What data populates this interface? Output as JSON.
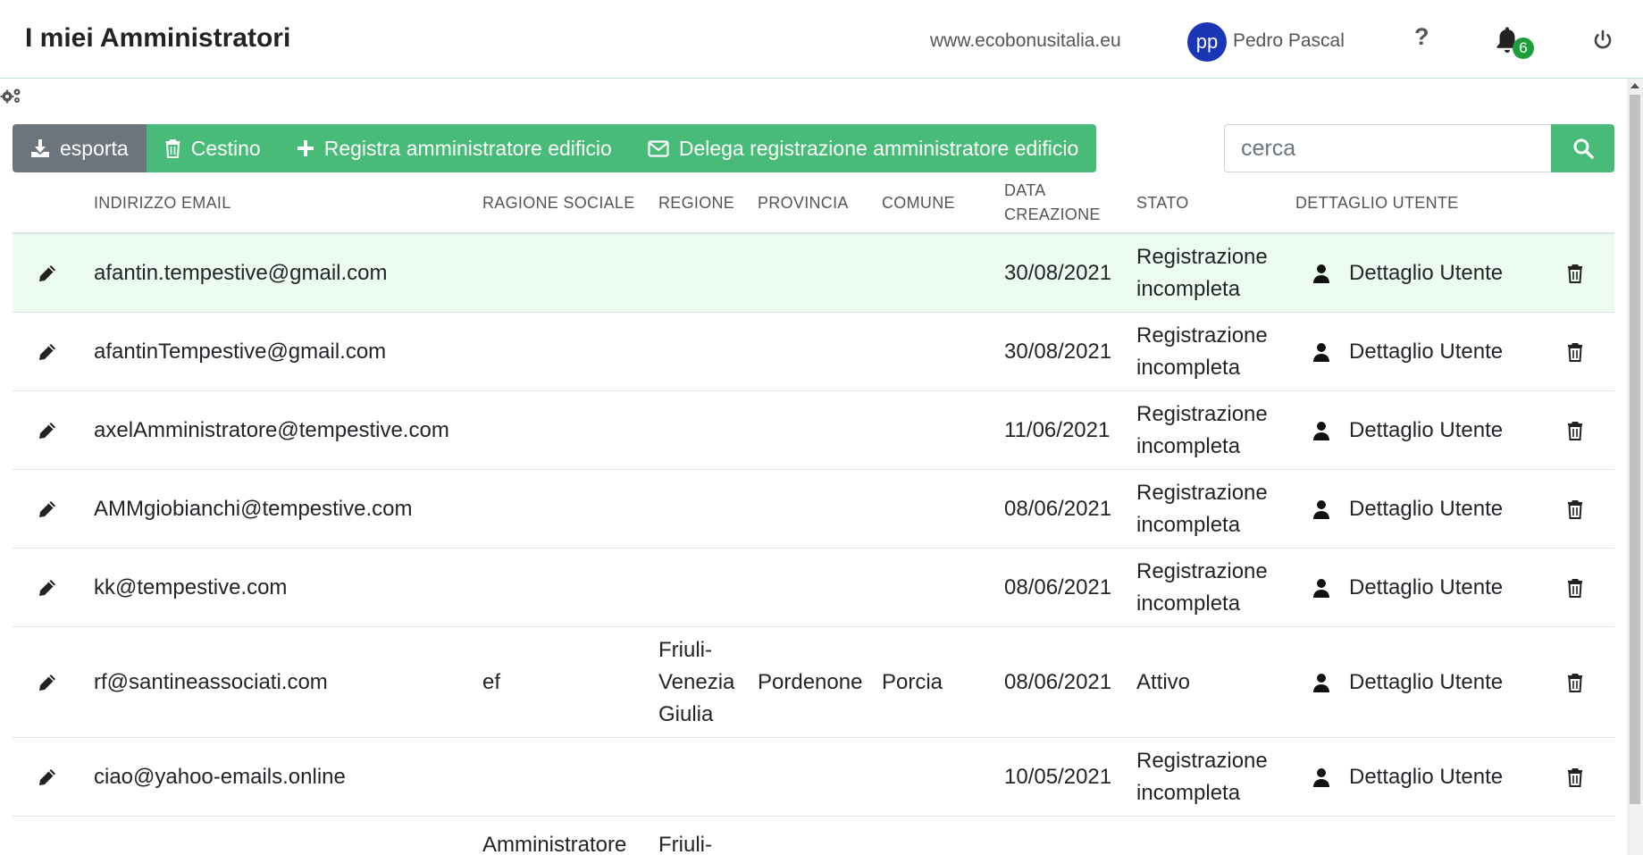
{
  "header": {
    "title": "I miei Amministratori",
    "site_link": "www.ecobonusitalia.eu",
    "avatar_initials": "pp",
    "user_name": "Pedro Pascal",
    "help_label": "?",
    "notifications_count": "6",
    "icons": [
      "bell-icon",
      "power-icon",
      "gear-icon"
    ]
  },
  "toolbar": {
    "export_label": "esporta",
    "trash_label": "Cestino",
    "register_label": "Registra amministratore edificio",
    "delegate_label": "Delega registrazione amministratore edificio",
    "search_placeholder": "cerca"
  },
  "colors": {
    "accent_green": "#48bb78",
    "export_gray": "#6c757d",
    "highlight_row": "#ecfcf1",
    "avatar_blue": "#1a35b5",
    "badge_green": "#1e9e3a"
  },
  "table": {
    "columns": [
      {
        "key": "email",
        "label": "INDIRIZZO EMAIL"
      },
      {
        "key": "ragione",
        "label": "RAGIONE SOCIALE"
      },
      {
        "key": "regione",
        "label": "REGIONE"
      },
      {
        "key": "provincia",
        "label": "PROVINCIA"
      },
      {
        "key": "comune",
        "label": "COMUNE"
      },
      {
        "key": "data",
        "label": "DATA CREAZIONE"
      },
      {
        "key": "stato",
        "label": "STATO"
      },
      {
        "key": "dettaglio",
        "label": "DETTAGLIO UTENTE"
      }
    ],
    "rows": [
      {
        "email": "afantin.tempestive@gmail.com",
        "ragione": "",
        "regione": "",
        "provincia": "",
        "comune": "",
        "data": "30/08/2021",
        "stato": "Registrazione incompleta",
        "dettaglio": "Dettaglio Utente",
        "highlighted": true
      },
      {
        "email": "afantinTempestive@gmail.com",
        "ragione": "",
        "regione": "",
        "provincia": "",
        "comune": "",
        "data": "30/08/2021",
        "stato": "Registrazione incompleta",
        "dettaglio": "Dettaglio Utente"
      },
      {
        "email": "axelAmministratore@tempestive.com",
        "ragione": "",
        "regione": "",
        "provincia": "",
        "comune": "",
        "data": "11/06/2021",
        "stato": "Registrazione incompleta",
        "dettaglio": "Dettaglio Utente"
      },
      {
        "email": "AMMgiobianchi@tempestive.com",
        "ragione": "",
        "regione": "",
        "provincia": "",
        "comune": "",
        "data": "08/06/2021",
        "stato": "Registrazione incompleta",
        "dettaglio": "Dettaglio Utente"
      },
      {
        "email": "kk@tempestive.com",
        "ragione": "",
        "regione": "",
        "provincia": "",
        "comune": "",
        "data": "08/06/2021",
        "stato": "Registrazione incompleta",
        "dettaglio": "Dettaglio Utente"
      },
      {
        "email": "rf@santineassociati.com",
        "ragione": "ef",
        "regione": "Friuli-Venezia Giulia",
        "provincia": "Pordenone",
        "comune": "Porcia",
        "data": "08/06/2021",
        "stato": "Attivo",
        "dettaglio": "Dettaglio Utente"
      },
      {
        "email": "ciao@yahoo-emails.online",
        "ragione": "",
        "regione": "",
        "provincia": "",
        "comune": "",
        "data": "10/05/2021",
        "stato": "Registrazione incompleta",
        "dettaglio": "Dettaglio Utente"
      },
      {
        "email": "",
        "ragione": "Amministratore",
        "regione": "Friuli-",
        "provincia": "",
        "comune": "",
        "data": "",
        "stato": "",
        "dettaglio": "",
        "partial": true
      }
    ]
  }
}
